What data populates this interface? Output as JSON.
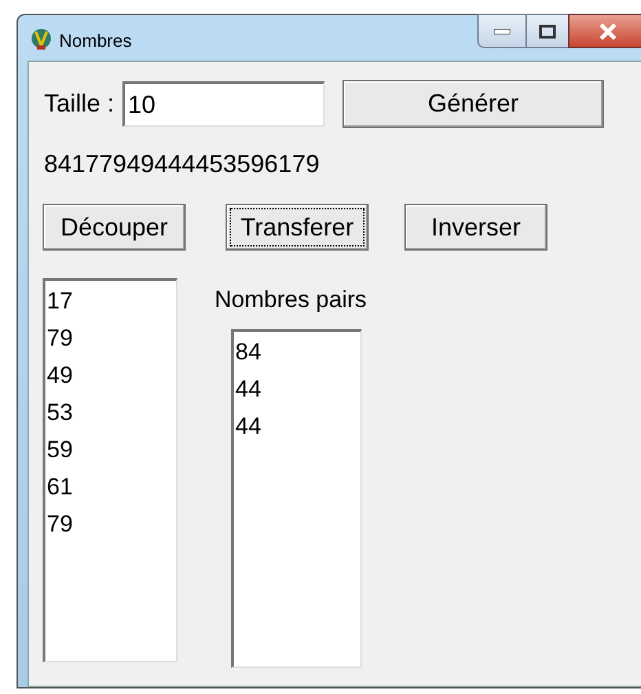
{
  "window": {
    "title": "Nombres"
  },
  "size_label": "Taille :",
  "size_field": {
    "value": "10"
  },
  "generate_button": {
    "label": "Générer",
    "focused": false
  },
  "generated_number": "84177949444453596179",
  "action_buttons": [
    {
      "label": "Découper",
      "focused": false
    },
    {
      "label": "Transferer",
      "focused": true
    },
    {
      "label": "Inverser",
      "focused": false
    }
  ],
  "numbers_list": {
    "items": [
      "17",
      "79",
      "49",
      "53",
      "59",
      "61",
      "79"
    ]
  },
  "even_list": {
    "title": "Nombres pairs",
    "items": [
      "84",
      "44",
      "44"
    ]
  }
}
